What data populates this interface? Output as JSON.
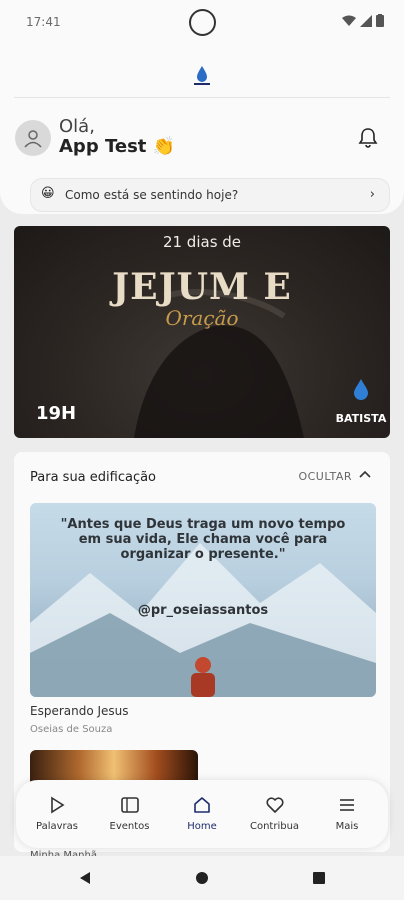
{
  "status_bar": {
    "time": "17:41"
  },
  "header": {
    "greeting": "Olá,",
    "user_name": "App Test 👏"
  },
  "mood_prompt": {
    "emoji": "😀",
    "text": "Como está se sentindo hoje?"
  },
  "banner": {
    "top_text": "21 dias de",
    "title": "JEJUM E",
    "script": "Oração",
    "hour": "19H",
    "brand": "BATISTA"
  },
  "edification": {
    "title": "Para sua edificação",
    "toggle_label": "OCULTAR",
    "post": {
      "quote": "\"Antes que Deus traga um novo tempo em sua vida, Ele chama você para organizar o presente.\"",
      "handle": "@pr_oseiassantos",
      "title": "Esperando Jesus",
      "author": "Oseias de Souza"
    }
  },
  "bottom_nav": {
    "items": [
      {
        "label": "Palavras",
        "icon": "play-icon"
      },
      {
        "label": "Eventos",
        "icon": "calendar-icon"
      },
      {
        "label": "Home",
        "icon": "home-icon"
      },
      {
        "label": "Contribua",
        "icon": "heart-icon"
      },
      {
        "label": "Mais",
        "icon": "menu-icon"
      }
    ],
    "active": "Home"
  },
  "peek_text": "Minha Manhã",
  "colors": {
    "accent": "#1e2c6b",
    "banner_bg": "#2b2522",
    "gold": "#c69b4b"
  }
}
